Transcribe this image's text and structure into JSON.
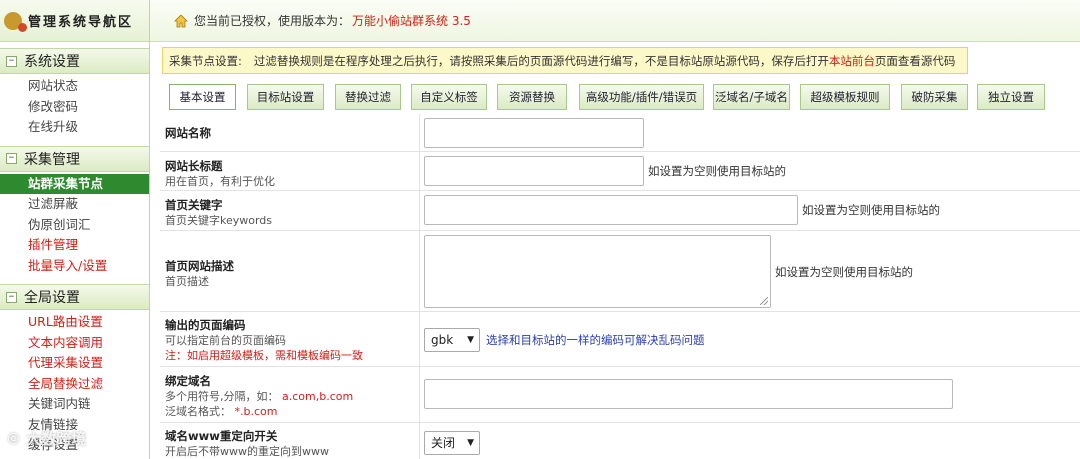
{
  "app": {
    "logo_text": "管理系统导航区",
    "status_text": "您当前已授权，使用版本为：",
    "version_text": "万能小偷站群系统 3.5"
  },
  "sidebar": {
    "groups": [
      {
        "label": "系统设置",
        "items": [
          {
            "label": "网站状态"
          },
          {
            "label": "修改密码"
          },
          {
            "label": "在线升级"
          }
        ]
      },
      {
        "label": "采集管理",
        "items": [
          {
            "label": "站群采集节点",
            "active": true
          },
          {
            "label": "过滤屏蔽"
          },
          {
            "label": "伪原创词汇"
          },
          {
            "label": "插件管理",
            "red": true
          },
          {
            "label": "批量导入/设置",
            "red": true
          }
        ]
      },
      {
        "label": "全局设置",
        "items": [
          {
            "label": "URL路由设置",
            "red": true
          },
          {
            "label": "文本内容调用",
            "red": true
          },
          {
            "label": "代理采集设置",
            "red": true
          },
          {
            "label": "全局替换过滤",
            "red": true
          },
          {
            "label": "关键词内链"
          },
          {
            "label": "友情链接"
          },
          {
            "label": "缓存设置"
          }
        ]
      }
    ]
  },
  "notice": {
    "label": "采集节点设置:",
    "text_before": "过滤替换规则是在程序处理之后执行，请按照采集后的页面源代码进行编写，不是目标站原站源代码，保存后打开",
    "text_link": "本站前台",
    "text_after": "页面查看源代码"
  },
  "tabs": [
    {
      "label": "基本设置",
      "active": true
    },
    {
      "label": "目标站设置"
    },
    {
      "label": "替换过滤"
    },
    {
      "label": "自定义标签"
    },
    {
      "label": "资源替换"
    },
    {
      "label": "高级功能/插件/错误页"
    },
    {
      "label": "泛域名/子域名"
    },
    {
      "label": "超级模板规则"
    },
    {
      "label": "破防采集"
    },
    {
      "label": "独立设置"
    }
  ],
  "form": {
    "site_name": {
      "title": "网站名称",
      "value": ""
    },
    "site_title": {
      "title": "网站长标题",
      "sub": "用在首页，有利于优化",
      "value": "",
      "hint": "如设置为空则使用目标站的"
    },
    "keywords": {
      "title": "首页关键字",
      "sub": "首页关键字keywords",
      "value": "",
      "hint": "如设置为空则使用目标站的"
    },
    "description": {
      "title": "首页网站描述",
      "sub": "首页描述",
      "value": "",
      "hint": "如设置为空则使用目标站的"
    },
    "encoding": {
      "title": "输出的页面编码",
      "sub": "可以指定前台的页面编码",
      "sub_red": "注：如启用超级模板，需和模板编码一致",
      "selected": "gbk",
      "hint": "选择和目标站的一样的编码可解决乱码问题"
    },
    "bind_domain": {
      "title": "绑定域名",
      "sub1_prefix": "多个用符号,分隔，如：",
      "sub1_example": "a.com,b.com",
      "sub2_prefix": "泛域名格式：",
      "sub2_example": "*.b.com",
      "value": ""
    },
    "www_redirect": {
      "title": "域名www重定向开关",
      "sub": "开启后不带www的重定向到www",
      "selected": "关闭"
    }
  },
  "watermark": "© 大数跨境"
}
